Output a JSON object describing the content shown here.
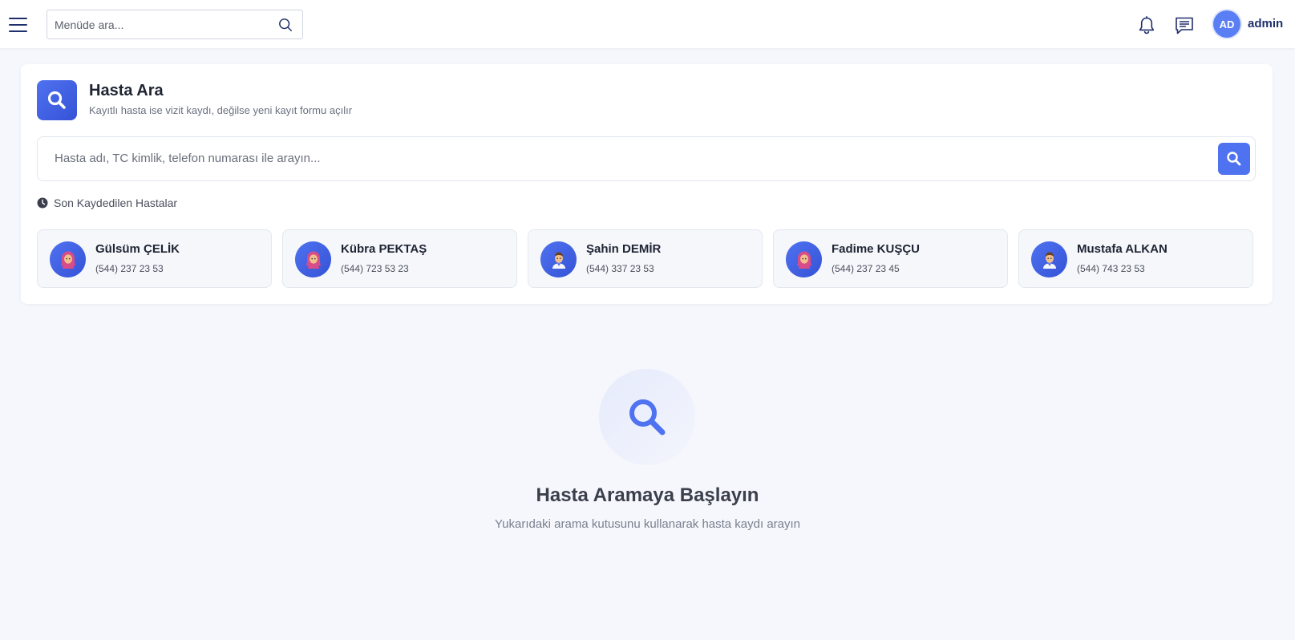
{
  "topbar": {
    "menu_search_placeholder": "Menüde ara...",
    "avatar_initials": "AD",
    "username": "admin"
  },
  "search_card": {
    "title": "Hasta Ara",
    "subtitle": "Kayıtlı hasta ise vizit kaydı, değilse yeni kayıt formu açılır",
    "search_placeholder": "Hasta adı, TC kimlik, telefon numarası ile arayın...",
    "recent_label": "Son Kaydedilen Hastalar"
  },
  "recent_patients": [
    {
      "name": "Gülsüm ÇELİK",
      "phone": "(544) 237 23 53",
      "avatar": "woman-headscarf-icon"
    },
    {
      "name": "Kübra PEKTAŞ",
      "phone": "(544) 723 53 23",
      "avatar": "woman-headscarf-icon"
    },
    {
      "name": "Şahin DEMİR",
      "phone": "(544) 337 23 53",
      "avatar": "man-icon"
    },
    {
      "name": "Fadime KUŞÇU",
      "phone": "(544) 237 23 45",
      "avatar": "woman-headscarf-icon"
    },
    {
      "name": "Mustafa ALKAN",
      "phone": "(544) 743 23 53",
      "avatar": "man-icon"
    }
  ],
  "empty_state": {
    "title": "Hasta Aramaya Başlayın",
    "subtitle": "Yukarıdaki arama kutusunu kullanarak hasta kaydı arayın"
  },
  "colors": {
    "accent": "#4f72f0",
    "navy": "#1f2f6b",
    "background": "#f5f7fc"
  }
}
